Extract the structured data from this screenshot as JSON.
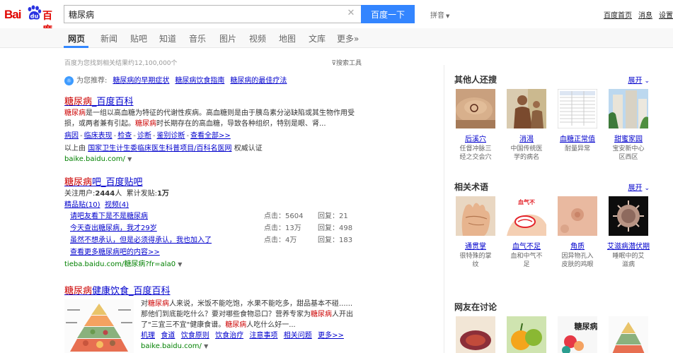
{
  "header": {
    "logo_bai": "Bai",
    "logo_du": "百度",
    "search_value": "糖尿病",
    "search_button": "百度一下",
    "pinyin": "拼音",
    "top_links": [
      "百度首页",
      "消息",
      "设置"
    ]
  },
  "tabs": [
    "网页",
    "新闻",
    "贴吧",
    "知道",
    "音乐",
    "图片",
    "视频",
    "地图",
    "文库",
    "更多»"
  ],
  "results_meta": {
    "count_text": "百度为您找到相关结果约12,100,000个",
    "search_tools": "搜索工具"
  },
  "recommend": {
    "label": "为您推荐:",
    "links": [
      "糖尿病的早期症状",
      "糖尿病饮食指南",
      "糖尿病的最佳疗法"
    ]
  },
  "results": [
    {
      "title_hl": "糖尿病",
      "title_rest": "_百度百科",
      "snippet_line1_hl": "糖尿病",
      "snippet_line1": "是一组以高血糖为特征的代谢性疾病。高血糖则是由于胰岛素分泌缺陷或其生物作用受",
      "snippet_line2_pre": "损，或两者兼有引起。",
      "snippet_line2_hl": "糖尿病",
      "snippet_line2_post": "时长期存在的高血糖，导致各种组织，特别是眼、肾...",
      "sublinks": [
        "病因",
        "临床表现",
        "检查",
        "诊断",
        "鉴别诊断",
        "查看全部>>"
      ],
      "cert_pre": "以上由",
      "cert_link": "国家卫生计生委临床医生科普项目/百科名医网",
      "cert_post": "权威认证",
      "url": "baike.baidu.com/"
    },
    {
      "title_hl": "糖尿病",
      "title_rest": "吧_百度贴吧",
      "follow_label": "关注用户:",
      "follow_value": "2444",
      "follow_unit": "人",
      "posts_label": "累计发贴:",
      "posts_value": "1万",
      "tab1": "精品贴(10)",
      "tab2": "视频(4)",
      "posts": [
        {
          "title": "请吧友看下是不是糖尿病",
          "clicks": "点击：5604",
          "replies": "回复：21"
        },
        {
          "title": "今天查出糖尿病，我才29岁",
          "clicks": "点击：13万",
          "replies": "回复：498"
        },
        {
          "title": "虽然不想承认，但是必须得承认，我也加入了",
          "clicks": "点击：4万",
          "replies": "回复：183"
        }
      ],
      "more": "查看更多糖尿病吧的内容>>",
      "url": "tieba.baidu.com/糖尿病?fr=ala0"
    },
    {
      "title_hl": "糖尿病",
      "title_rest": "健康饮食_百度百科",
      "line1_pre": "对",
      "line1_hl": "糖尿病",
      "line1_post": "人来说，米饭不能吃饱，水果不能吃多，甜品基本不碰......",
      "line2_pre": "那他们到底能吃什么？要对哪些食物忌口？营养专家为",
      "line2_hl": "糖尿病",
      "line2_post": "人开出",
      "line3_pre": "了\"三宜三不宜\"健康食谱。",
      "line3_hl": "糖尿病",
      "line3_post": "人吃什么好一...",
      "sublinks": [
        "机理",
        "食道",
        "饮食原则",
        "饮食治疗",
        "注意事项",
        "相关问题",
        "更多>>"
      ],
      "url": "baike.baidu.com/"
    }
  ],
  "right": {
    "others_title": "其他人还搜",
    "expand": "展开",
    "others": [
      {
        "name": "后溪穴",
        "desc1": "任督冲脉三",
        "desc2": "经之交会穴"
      },
      {
        "name": "消渴",
        "desc1": "中国传统医",
        "desc2": "学的病名"
      },
      {
        "name": "血糖正常值",
        "desc1": "耐量异常",
        "desc2": ""
      },
      {
        "name": "甜蜜家园",
        "desc1": "宝安新中心",
        "desc2": "区西区"
      }
    ],
    "terms_title": "相关术语",
    "terms": [
      {
        "name": "通贯掌",
        "desc1": "很特殊的掌",
        "desc2": "纹"
      },
      {
        "name": "血气不足",
        "desc1": "血和中气不",
        "desc2": "足"
      },
      {
        "name": "角质",
        "desc1": "因异物孔入",
        "desc2": "皮肤的鸡眼"
      },
      {
        "name": "艾滋病潜伏期",
        "desc1": "睡眠中的艾",
        "desc2": "滋病"
      }
    ],
    "term2_overlay": "血气不",
    "discuss_title": "网友在讨论",
    "discuss_overlay": "糖尿病"
  }
}
